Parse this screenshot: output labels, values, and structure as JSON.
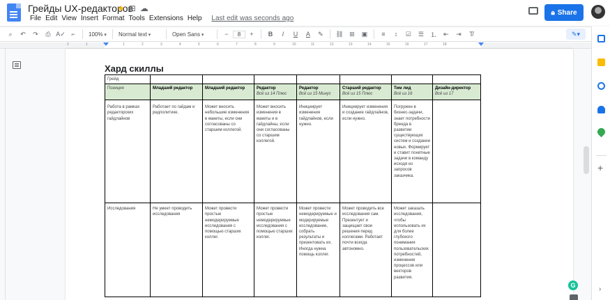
{
  "header": {
    "title": "Грейды UX-редакторов",
    "menus": [
      "File",
      "Edit",
      "View",
      "Insert",
      "Format",
      "Tools",
      "Extensions",
      "Help"
    ],
    "last_edit": "Last edit was seconds ago",
    "share_label": "Share"
  },
  "toolbar": {
    "zoom": "100%",
    "style": "Normal text",
    "font": "Open Sans",
    "font_size": "8"
  },
  "ruler": {
    "numbers": [
      "2",
      "1",
      "",
      "1",
      "2",
      "3",
      "4",
      "5",
      "6",
      "7",
      "8",
      "9",
      "10",
      "11",
      "12",
      "13",
      "14",
      "15",
      "16",
      "17",
      "18"
    ]
  },
  "document": {
    "heading": "Хард скиллы",
    "grade_label": "Грейд",
    "position_label": "Позиция",
    "columns": [
      {
        "title": "Младший редактор",
        "sub": ""
      },
      {
        "title": "Младший редактор",
        "sub": ""
      },
      {
        "title": "Редактор",
        "sub": "Всё из 14 Плюс"
      },
      {
        "title": "Редактор",
        "sub": "Всё из 15 Минус"
      },
      {
        "title": "Старший редактор",
        "sub": "Всё из 15 Плюс"
      },
      {
        "title": "Тим лид",
        "sub": "Всё из 16"
      },
      {
        "title": "Дизайн-директор",
        "sub": "Всё из 17"
      }
    ],
    "rows": [
      {
        "label": "Работа в рамках редакторских гайдлайнов",
        "cells": [
          "Работает по гайдам и редполитике.",
          "Может вносить небольшие изменения в макеты, если они согласованы со старшим коллегой.",
          "Может вносить изменения в макеты и в гайдлайны, если они согласованы со старшим коллегой.",
          "Инициирует изменения гайдлайнов, если нужно.",
          "Инициирует изменения и создание гайдлайнов, если нужно.",
          "Погружен в бизнес-задачи, знает потребности бренда в развитии существующих систем и создании новых. Формирует и ставит понятные задачи в команду исходя из запросов заказчика.",
          ""
        ]
      },
      {
        "label": "Исследования",
        "cells": [
          "Не умеет проводить исследования",
          "Может провести простые немодерируемые исследования с помощью старших коллег.",
          "Может провести простые немодерируемые исследования с помощью старших коллег.",
          "Может провести немодерируемые и модерируемые исследование, собрать результаты и презентовать их. Иногда нужна помощь коллег.",
          "Может проводить все исследования сам. Презентует и защищает свои решения перед коллегами. Работает почти всегда автономно.",
          "Может заказать исследования, чтобы использовать их для более глубокого понимания пользовательских потребностей, изменения процессов или векторов развития.",
          ""
        ]
      }
    ]
  },
  "colors": {
    "share": "#1a73e8",
    "header_row_bg": "#d9ead3",
    "doc_icon": "#4285f4",
    "star": "#f4b400"
  }
}
